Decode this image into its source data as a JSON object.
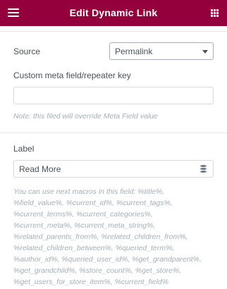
{
  "header": {
    "title": "Edit Dynamic Link"
  },
  "source": {
    "label": "Source",
    "selected": "Permalink"
  },
  "meta_key": {
    "label": "Custom meta field/repeater key",
    "value": "",
    "placeholder": "",
    "note": "Note: this filed will override Meta Field value"
  },
  "label_field": {
    "label": "Label",
    "value": "Read More"
  },
  "macros": {
    "lines": [
      "You can use next macros in this field: %title%,",
      "%field_value%, %current_id%, %current_tags%,",
      "%current_terms%, %current_categories%,",
      "%current_meta%, %current_meta_string%,",
      "%related_parents_from%, %related_children_from%,",
      "%related_children_between%, %queried_term%,",
      "%author_id%, %queried_user_id%, %get_grandparent%,",
      "%get_grandchild%, %store_count%, %get_store%,",
      "%get_users_for_store_item%, %current_field%"
    ]
  },
  "colors": {
    "header_bg": "#93003c",
    "note_text": "#a4afb7",
    "label_text": "#495157"
  },
  "icons": {
    "menu": "hamburger-menu-icon",
    "apps": "grid-icon",
    "dynamic": "database-icon",
    "dropdown": "chevron-down-icon"
  }
}
